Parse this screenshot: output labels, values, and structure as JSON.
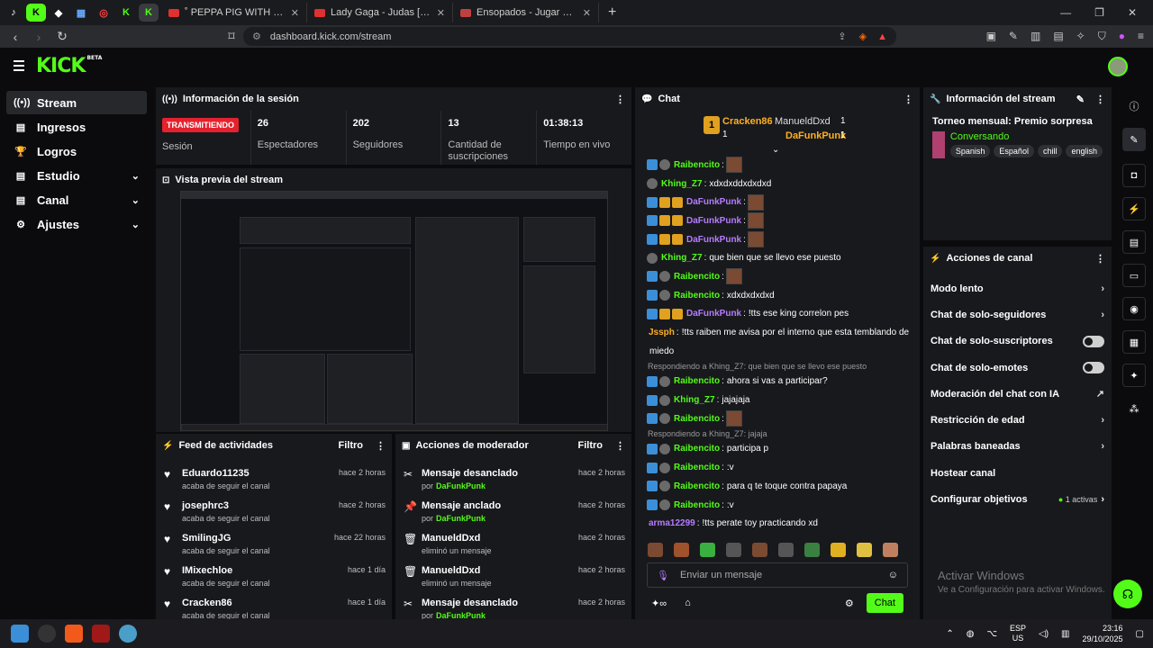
{
  "browser": {
    "tabs": [
      {
        "title": "˚ PEPPA PIG WITH JAPANESE AND E",
        "color": "#e03030"
      },
      {
        "title": "Lady Gaga - Judas [Sukuna Vs Sa",
        "color": "#e03030"
      },
      {
        "title": "Ensopados - Jugar sopas de letras en",
        "color": "#c04040"
      }
    ],
    "url": "dashboard.kick.com/stream",
    "pinned": [
      "tiktok",
      "kick",
      "bookmark",
      "apps",
      "extension",
      "kick",
      "kick"
    ]
  },
  "app": {
    "logo": "KICK",
    "logo_beta": "BETA",
    "accent": "#53fc18"
  },
  "sidebar": {
    "items": [
      {
        "label": "Stream",
        "icon": "stream-icon"
      },
      {
        "label": "Ingresos",
        "icon": "revenue-icon"
      },
      {
        "label": "Logros",
        "icon": "trophy-icon"
      },
      {
        "label": "Estudio",
        "icon": "studio-icon"
      },
      {
        "label": "Canal",
        "icon": "channel-icon"
      },
      {
        "label": "Ajustes",
        "icon": "gear-icon"
      }
    ]
  },
  "session": {
    "title": "Información de la sesión",
    "status": "TRANSMITIENDO",
    "status_label": "Sesión",
    "stats": [
      {
        "value": "26",
        "label": "Espectadores"
      },
      {
        "value": "202",
        "label": "Seguidores"
      },
      {
        "value": "13",
        "label": "Cantidad de suscripciones"
      },
      {
        "value": "01:38:13",
        "label": "Tiempo en vivo"
      }
    ]
  },
  "preview": {
    "title": "Vista previa del stream"
  },
  "feed": {
    "title": "Feed de actividades",
    "filter": "Filtro",
    "items": [
      {
        "name": "Eduardo11235",
        "sub": "acaba de seguir el canal",
        "time": "hace 2 horas"
      },
      {
        "name": "josephrc3",
        "sub": "acaba de seguir el canal",
        "time": "hace 2 horas"
      },
      {
        "name": "SmilingJG",
        "sub": "acaba de seguir el canal",
        "time": "hace 22 horas"
      },
      {
        "name": "IMixechloe",
        "sub": "acaba de seguir el canal",
        "time": "hace 1 día"
      },
      {
        "name": "Cracken86",
        "sub": "acaba de seguir el canal",
        "time": "hace 1 día"
      }
    ]
  },
  "mod": {
    "title": "Acciones de moderador",
    "filter": "Filtro",
    "items": [
      {
        "action": "Mensaje desanclado",
        "by": "por",
        "user": "DaFunkPunk",
        "time": "hace 2 horas"
      },
      {
        "action": "Mensaje anclado",
        "by": "por",
        "user": "DaFunkPunk",
        "time": "hace 2 horas"
      },
      {
        "action": "ManueldDxd",
        "by": "eliminó un mensaje",
        "user": "",
        "time": "hace 2 horas"
      },
      {
        "action": "ManueldDxd",
        "by": "eliminó un mensaje",
        "user": "",
        "time": "hace 2 horas"
      },
      {
        "action": "Mensaje desanclado",
        "by": "por",
        "user": "DaFunkPunk",
        "time": "hace 2 horas"
      }
    ]
  },
  "chat": {
    "title": "Chat",
    "top": [
      {
        "rank": "1",
        "name": "Cracken86",
        "count": "1"
      },
      {
        "name": "ManueldDxd",
        "count": "1"
      },
      {
        "name": "DaFunkPunk",
        "count": "1"
      }
    ],
    "messages": [
      {
        "user": "Raibencito",
        "color": "#53fc18",
        "text": "",
        "emote": true,
        "badges": [
          "bl",
          "gr"
        ]
      },
      {
        "user": "Khing_Z7",
        "color": "#53fc18",
        "text": "xdxdxddxdxdxd",
        "emote": false,
        "badges": [
          "gr"
        ]
      },
      {
        "user": "DaFunkPunk",
        "color": "#b57cff",
        "text": "",
        "emote": true,
        "badges": [
          "bl",
          "cr",
          "cr"
        ]
      },
      {
        "user": "DaFunkPunk",
        "color": "#b57cff",
        "text": "",
        "emote": true,
        "badges": [
          "bl",
          "cr",
          "cr"
        ]
      },
      {
        "user": "DaFunkPunk",
        "color": "#b57cff",
        "text": "",
        "emote": true,
        "badges": [
          "bl",
          "cr",
          "cr"
        ]
      },
      {
        "user": "Khing_Z7",
        "color": "#53fc18",
        "text": "que bien que se llevo ese puesto",
        "emote": false,
        "badges": [
          "gr"
        ]
      },
      {
        "user": "Raibencito",
        "color": "#53fc18",
        "text": "",
        "emote": true,
        "badges": [
          "bl",
          "gr"
        ]
      },
      {
        "user": "Raibencito",
        "color": "#53fc18",
        "text": "xdxdxdxdxd",
        "emote": false,
        "badges": [
          "bl",
          "gr"
        ]
      },
      {
        "user": "DaFunkPunk",
        "color": "#b57cff",
        "text": "!tts ese king correlon pes",
        "emote": false,
        "badges": [
          "bl",
          "cr",
          "cr"
        ]
      },
      {
        "user": "Jssph",
        "color": "#ffb020",
        "text": "!tts raiben me avisa por el interno que esta temblando de",
        "emote": false,
        "badges": []
      },
      {
        "user": "",
        "color": "#fff",
        "text": "miedo",
        "emote": false,
        "badges": [],
        "plain": true
      },
      {
        "reply": "Respondiendo a Khing_Z7: que bien que se llevo ese puesto"
      },
      {
        "user": "Raibencito",
        "color": "#53fc18",
        "text": "ahora si vas a participar?",
        "emote": false,
        "badges": [
          "bl",
          "gr"
        ]
      },
      {
        "user": "Khing_Z7",
        "color": "#53fc18",
        "text": "jajajaja",
        "emote": false,
        "badges": [
          "bl",
          "gr"
        ]
      },
      {
        "user": "Raibencito",
        "color": "#53fc18",
        "text": "",
        "emote": true,
        "badges": [
          "bl",
          "gr"
        ]
      },
      {
        "reply": "Respondiendo a Khing_Z7: jajaja"
      },
      {
        "user": "Raibencito",
        "color": "#53fc18",
        "text": "participa p",
        "emote": false,
        "badges": [
          "bl",
          "gr"
        ]
      },
      {
        "user": "Raibencito",
        "color": "#53fc18",
        "text": ":v",
        "emote": false,
        "badges": [
          "bl",
          "gr"
        ]
      },
      {
        "user": "Raibencito",
        "color": "#53fc18",
        "text": "para q te toque contra papaya",
        "emote": false,
        "badges": [
          "bl",
          "gr"
        ]
      },
      {
        "user": "Raibencito",
        "color": "#53fc18",
        "text": ":v",
        "emote": false,
        "badges": [
          "bl",
          "gr"
        ]
      },
      {
        "user": "arma12299",
        "color": "#b57cff",
        "text": "!tts perate toy practicando xd",
        "emote": false,
        "badges": []
      }
    ],
    "input_placeholder": "Enviar un mensaje",
    "send_label": "Chat"
  },
  "stream_info": {
    "title": "Información del stream",
    "stream_title": "Torneo mensual: Premio sorpresa",
    "category": "Conversando",
    "tags": [
      "Spanish",
      "Español",
      "chill",
      "english"
    ]
  },
  "channel_actions": {
    "title": "Acciones de canal",
    "items": [
      {
        "label": "Modo lento",
        "type": "chevron"
      },
      {
        "label": "Chat de solo-seguidores",
        "type": "chevron"
      },
      {
        "label": "Chat de solo-suscriptores",
        "type": "toggle"
      },
      {
        "label": "Chat de solo-emotes",
        "type": "toggle"
      },
      {
        "label": "Moderación del chat con IA",
        "type": "external"
      },
      {
        "label": "Restricción de edad",
        "type": "chevron"
      },
      {
        "label": "Palabras baneadas",
        "type": "chevron"
      },
      {
        "label": "Hostear canal",
        "type": "none"
      },
      {
        "label": "Configurar objetivos",
        "type": "goal",
        "extra": "1 activas"
      }
    ]
  },
  "watermark": {
    "line1": "Activar Windows",
    "line2": "Ve a Configuración para activar Windows."
  },
  "taskbar": {
    "lang": "ESP",
    "region": "US",
    "time": "23:16",
    "date": "29/10/2025"
  }
}
